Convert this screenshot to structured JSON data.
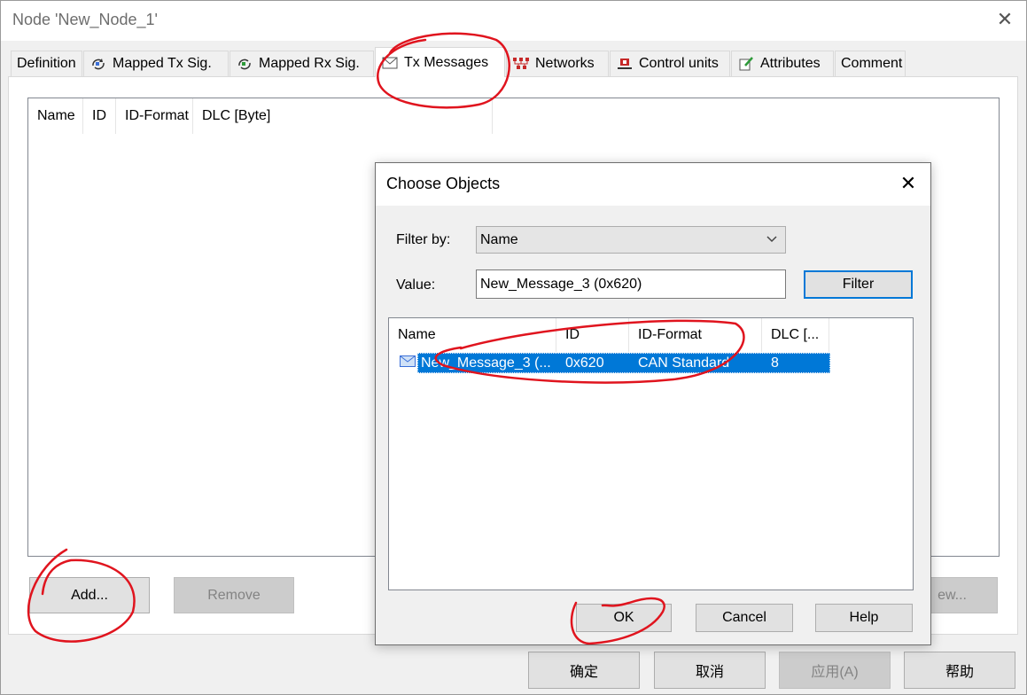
{
  "window": {
    "title": "Node 'New_Node_1'",
    "close": "✕"
  },
  "tabs": [
    {
      "label": "Definition",
      "icon": "none"
    },
    {
      "label": "Mapped Tx Sig.",
      "icon": "mapped-tx-icon"
    },
    {
      "label": "Mapped Rx Sig.",
      "icon": "mapped-rx-icon"
    },
    {
      "label": "Tx Messages",
      "icon": "envelope-icon",
      "active": true
    },
    {
      "label": "Networks",
      "icon": "network-icon"
    },
    {
      "label": "Control units",
      "icon": "control-unit-icon"
    },
    {
      "label": "Attributes",
      "icon": "attributes-icon"
    },
    {
      "label": "Comment",
      "icon": "none"
    }
  ],
  "main_list": {
    "columns": [
      "Name",
      "ID",
      "ID-Format",
      "DLC [Byte]"
    ]
  },
  "main_buttons": {
    "add": "Add...",
    "remove": "Remove",
    "view": "ew..."
  },
  "footer_buttons": {
    "ok": "确定",
    "cancel": "取消",
    "apply": "应用(A)",
    "help": "帮助"
  },
  "dialog": {
    "title": "Choose Objects",
    "close": "✕",
    "filter_by_label": "Filter by:",
    "filter_by_value": "Name",
    "value_label": "Value:",
    "value_text": "New_Message_3 (0x620)",
    "filter_button": "Filter",
    "columns": [
      "Name",
      "ID",
      "ID-Format",
      "DLC [..."
    ],
    "rows": [
      {
        "name": "New_Message_3 (...",
        "id": "0x620",
        "format": "CAN Standard",
        "dlc": "8"
      }
    ],
    "buttons": {
      "ok": "OK",
      "cancel": "Cancel",
      "help": "Help"
    }
  },
  "colors": {
    "selection": "#0078d7",
    "annotation": "#e0141e"
  }
}
